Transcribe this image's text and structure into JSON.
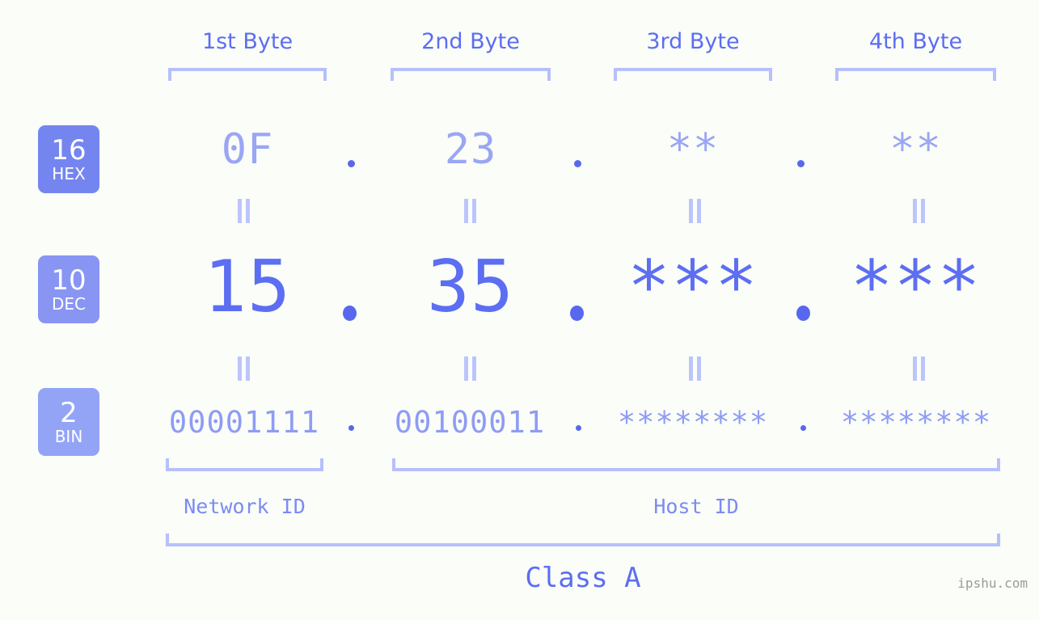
{
  "meta": {
    "watermark": "ipshu.com",
    "background_color": "#fbfdf8",
    "accent_color": "#5c6ef2",
    "accent_light_color": "#9aa6f4",
    "bracket_color": "#b6c0fb"
  },
  "byte_headers": [
    {
      "label": "1st Byte"
    },
    {
      "label": "2nd Byte"
    },
    {
      "label": "3rd Byte"
    },
    {
      "label": "4th Byte"
    }
  ],
  "bases": [
    {
      "number": "16",
      "name": "HEX",
      "color": "#7585f0"
    },
    {
      "number": "10",
      "name": "DEC",
      "color": "#8895f3"
    },
    {
      "number": "2",
      "name": "BIN",
      "color": "#93a4f7"
    }
  ],
  "rows": {
    "hex": {
      "values": [
        "0F",
        "23",
        "**",
        "**"
      ],
      "separator": "."
    },
    "dec": {
      "values": [
        "15",
        "35",
        "***",
        "***"
      ],
      "separator": "."
    },
    "bin": {
      "values": [
        "00001111",
        "00100011",
        "********",
        "********"
      ],
      "separator": "."
    }
  },
  "equals_mark": "||",
  "regions": [
    {
      "label": "Network ID"
    },
    {
      "label": "Host ID"
    }
  ],
  "class": {
    "label": "Class A"
  }
}
